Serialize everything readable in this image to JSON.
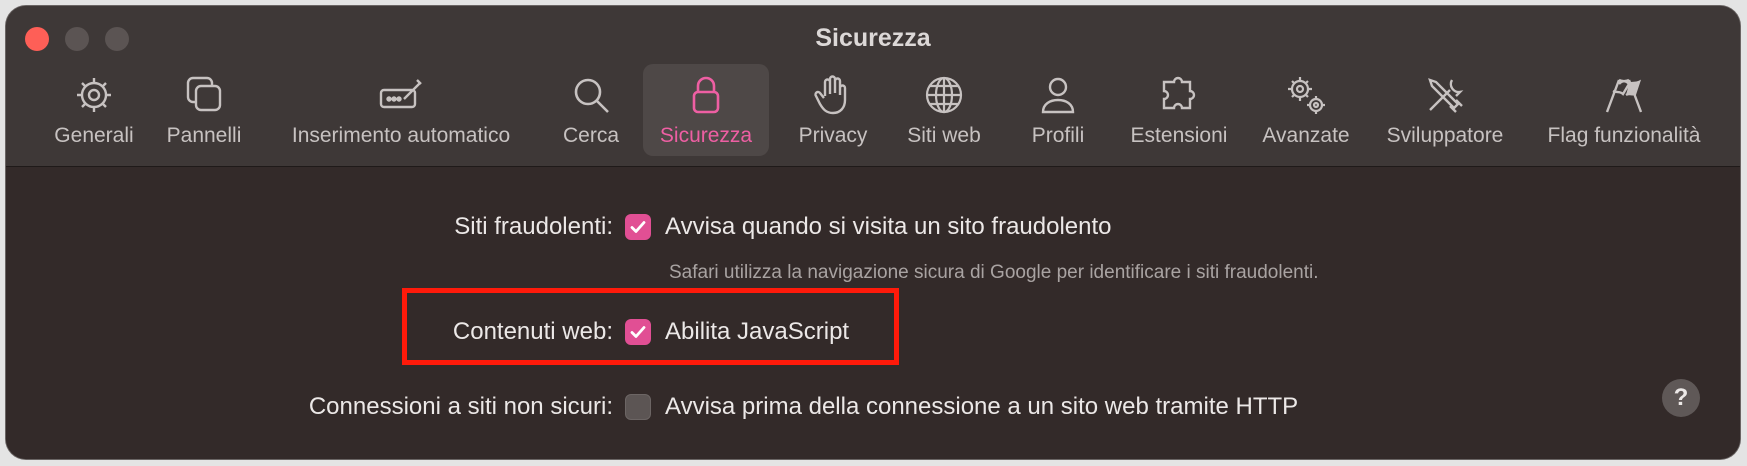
{
  "window": {
    "title": "Sicurezza"
  },
  "toolbar": {
    "tabs": [
      {
        "label": "Generali",
        "icon": "gear-icon"
      },
      {
        "label": "Pannelli",
        "icon": "tabs-icon"
      },
      {
        "label": "Inserimento automatico",
        "icon": "autofill-pencil-icon"
      },
      {
        "label": "Cerca",
        "icon": "search-icon"
      },
      {
        "label": "Sicurezza",
        "icon": "lock-icon",
        "selected": true
      },
      {
        "label": "Privacy",
        "icon": "hand-icon"
      },
      {
        "label": "Siti web",
        "icon": "globe-icon"
      },
      {
        "label": "Profili",
        "icon": "person-icon"
      },
      {
        "label": "Estensioni",
        "icon": "puzzle-icon"
      },
      {
        "label": "Avanzate",
        "icon": "gears-icon"
      },
      {
        "label": "Sviluppatore",
        "icon": "tools-icon"
      },
      {
        "label": "Flag funzionalità",
        "icon": "flags-icon"
      }
    ]
  },
  "settings": {
    "fraudulent": {
      "label": "Siti fraudolenti:",
      "option": "Avvisa quando si visita un sito fraudolento",
      "checked": true,
      "hint": "Safari utilizza la navigazione sicura di Google per identificare i siti fraudolenti."
    },
    "web_content": {
      "label": "Contenuti web:",
      "option": "Abilita JavaScript",
      "checked": true
    },
    "insecure": {
      "label": "Connessioni a siti non sicuri:",
      "option": "Avvisa prima della connessione a un sito web tramite HTTP",
      "checked": false
    }
  },
  "help": {
    "label": "?"
  },
  "colors": {
    "accent": "#e14f94",
    "highlight_border": "#ff1a0a",
    "close_button": "#fe5f57"
  }
}
